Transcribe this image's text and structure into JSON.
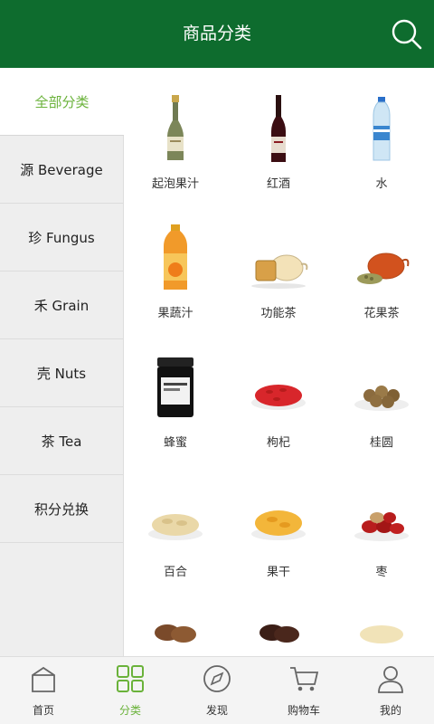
{
  "header": {
    "title": "商品分类",
    "search_icon": "search-icon"
  },
  "sidebar": {
    "items": [
      {
        "label": "全部分类",
        "active": true
      },
      {
        "label": "源 Beverage"
      },
      {
        "label": "珍 Fungus"
      },
      {
        "label": "禾 Grain"
      },
      {
        "label": "壳 Nuts"
      },
      {
        "label": "茶 Tea"
      },
      {
        "label": "积分兑换"
      }
    ]
  },
  "products": [
    {
      "label": "起泡果汁",
      "icon": "sparkling-juice-bottle"
    },
    {
      "label": "红酒",
      "icon": "red-wine-bottle"
    },
    {
      "label": "水",
      "icon": "water-bottle"
    },
    {
      "label": "果蔬汁",
      "icon": "juice-bottle"
    },
    {
      "label": "功能茶",
      "icon": "tea-pot-cups"
    },
    {
      "label": "花果茶",
      "icon": "fruit-tea-pot"
    },
    {
      "label": "蜂蜜",
      "icon": "honey-jar"
    },
    {
      "label": "枸杞",
      "icon": "goji-berries"
    },
    {
      "label": "桂圆",
      "icon": "longan"
    },
    {
      "label": "百合",
      "icon": "dried-lily"
    },
    {
      "label": "果干",
      "icon": "dried-fruit"
    },
    {
      "label": "枣",
      "icon": "red-dates"
    }
  ],
  "tabbar": {
    "items": [
      {
        "label": "首页",
        "icon": "home-icon"
      },
      {
        "label": "分类",
        "icon": "grid-icon",
        "active": true
      },
      {
        "label": "发现",
        "icon": "compass-icon"
      },
      {
        "label": "购物车",
        "icon": "cart-icon"
      },
      {
        "label": "我的",
        "icon": "user-icon"
      }
    ]
  },
  "colors": {
    "brand_green": "#0e6c2e",
    "accent": "#6ab23a",
    "sidebar_bg": "#eeeeee",
    "tabbar_bg": "#f4f4f4"
  }
}
